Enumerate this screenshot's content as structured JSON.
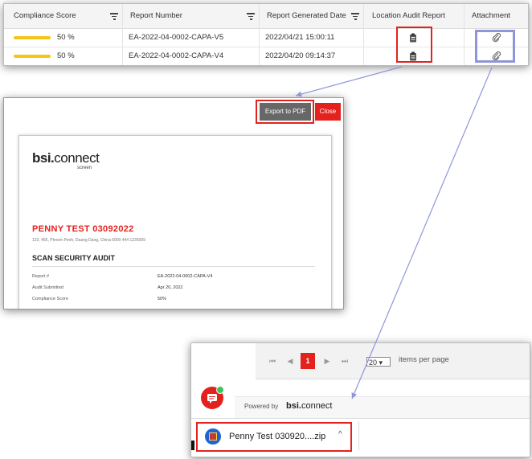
{
  "table": {
    "headers": [
      "Compliance Score",
      "Report Number",
      "Report Generated Date",
      "Location Audit Report",
      "Attachment"
    ],
    "rows": [
      {
        "score_text": "50 %",
        "score_value": 50,
        "report_number": "EA-2022-04-0002-CAPA-V5",
        "date": "2022/04/21 15:00:11"
      },
      {
        "score_text": "50 %",
        "score_value": 50,
        "report_number": "EA-2022-04-0002-CAPA-V4",
        "date": "2022/04/20 09:14:37"
      }
    ],
    "icons": {
      "audit": "clipboard-icon",
      "attachment": "paperclip-icon",
      "filter": "filter-icon"
    }
  },
  "preview": {
    "export_label": "Export to PDF",
    "close_label": "Close",
    "logo_main": "bsi.",
    "logo_accent": "connect",
    "logo_sub": "screen",
    "report_title": "PENNY TEST 03092022",
    "address": "123, 456, Phnom Penh, Daang Dang, China 5000 444 1235009",
    "section": "SCAN SECURITY AUDIT",
    "fields": [
      {
        "key": "Report #",
        "value": "EA-2022-04-0002-CAPA-V4"
      },
      {
        "key": "Audit Submitted",
        "value": "Apr 20, 2022"
      },
      {
        "key": "Compliance Score",
        "value": "50%"
      }
    ]
  },
  "download": {
    "pager": {
      "first": "⏮",
      "prev": "◀",
      "page": "1",
      "next": "▶",
      "last": "⏭"
    },
    "per_page_value": "20",
    "per_page_label": "items per page",
    "powered_by": "Powered by",
    "brand_main": "bsi.",
    "brand_accent": "connect",
    "file_name": "Penny Test 030920....zip",
    "caret": "^"
  },
  "colors": {
    "accent_red": "#e3221e",
    "highlight_blue": "#8f96d8",
    "score_bar": "#f5c518"
  }
}
